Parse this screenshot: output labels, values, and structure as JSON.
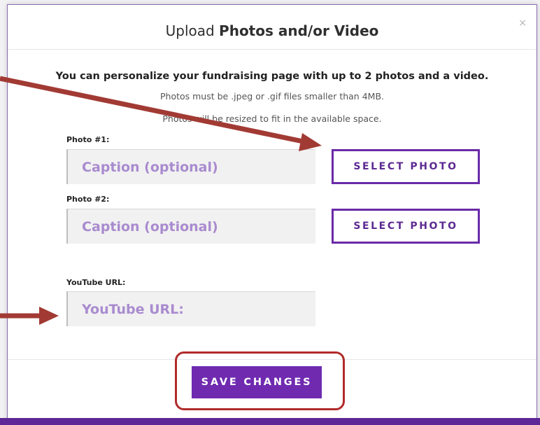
{
  "dialog": {
    "title_regular": "Upload ",
    "title_bold": "Photos and/or Video",
    "close_label": "×"
  },
  "intro": {
    "heading": "You can personalize your fundraising page with up to 2 photos and a video.",
    "note_format": "Photos must be .jpeg or .gif files smaller than 4MB.",
    "note_resize": "Photos will be resized to fit in the available space."
  },
  "photo1": {
    "label": "Photo #1:",
    "placeholder": "Caption (optional)",
    "button_label": "SELECT PHOTO"
  },
  "photo2": {
    "label": "Photo #2:",
    "placeholder": "Caption (optional)",
    "button_label": "SELECT PHOTO"
  },
  "youtube": {
    "label": "YouTube URL:",
    "placeholder": "YouTube URL:"
  },
  "footer": {
    "save_label": "SAVE CHANGES"
  },
  "colors": {
    "accent_purple": "#6f2ab0",
    "placeholder_lavender": "#a98bcf",
    "annotation_red": "#b12b2b"
  }
}
